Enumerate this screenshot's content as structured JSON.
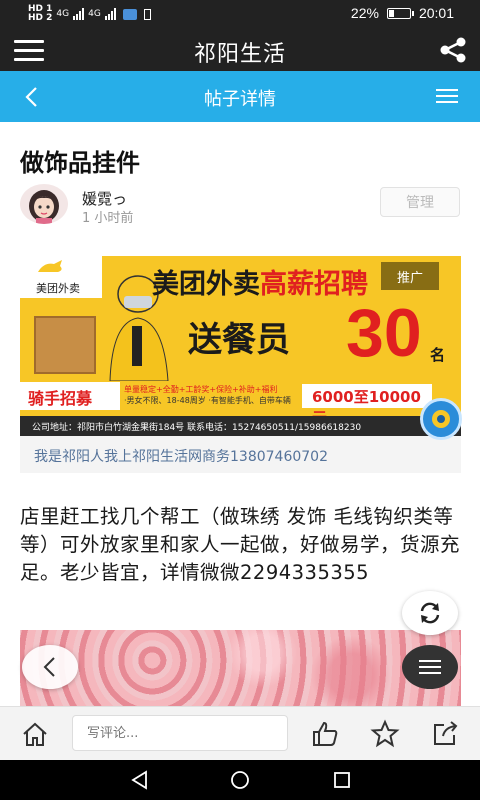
{
  "status_bar": {
    "left_labels": [
      "HD 1",
      "HD 2",
      "4G",
      "4G"
    ],
    "battery_percent": "22%",
    "battery_level": 0.22,
    "time": "20:01"
  },
  "app_header": {
    "title": "祁阳生活",
    "menu_icon": "hamburger-icon",
    "share_icon": "share-icon"
  },
  "sub_header": {
    "title": "帖子详情",
    "back_icon": "chevron-left-icon",
    "menu_icon": "menu-lines-icon"
  },
  "post": {
    "title": "做饰品挂件",
    "author": "媛霓っ",
    "time": "1 小时前",
    "manage_label": "管理",
    "body": "店里赶工找几个帮工（做珠绣 发饰 毛线钩织类等等）可外放家里和家人一起做，好做易学，货源充足。老少皆宜，详情微微2294335355"
  },
  "ad": {
    "tag": "推广",
    "logo_text": "美团外卖",
    "brand": "美团外卖",
    "brand_highlight": "高薪招聘",
    "headline": "送餐员",
    "count": "30",
    "count_unit": "名",
    "rider_label": "骑手招募",
    "details_line1": "单量稳定+全勤+工龄奖+保险+补助+福利",
    "details_line2": "·男女不限、18-48周岁  ·有智能手机、自带车辆",
    "salary": "6000至10000元",
    "footer": "公司地址：祁阳市白竹湖金果街184号    联系电话：15274650511/15986618230",
    "caption": "我是祁阳人我上祁阳生活网商务13807460702"
  },
  "floating": {
    "refresh_icon": "refresh-icon",
    "back_icon": "chevron-left-icon",
    "menu_icon": "menu-lines-icon",
    "eye_icon": "eye-icon"
  },
  "bottom_bar": {
    "home_icon": "home-icon",
    "comment_placeholder": "写评论...",
    "like_icon": "thumbs-up-icon",
    "favorite_icon": "star-icon",
    "share_icon": "share-out-icon"
  },
  "nav_bar": {
    "back_icon": "triangle-back-icon",
    "home_icon": "circle-home-icon",
    "recents_icon": "square-recents-icon"
  },
  "colors": {
    "header_bg": "#222222",
    "accent_blue": "#27aee8",
    "ad_yellow": "#f7c626",
    "ad_red": "#e02020",
    "caption_blue": "#55739a"
  }
}
